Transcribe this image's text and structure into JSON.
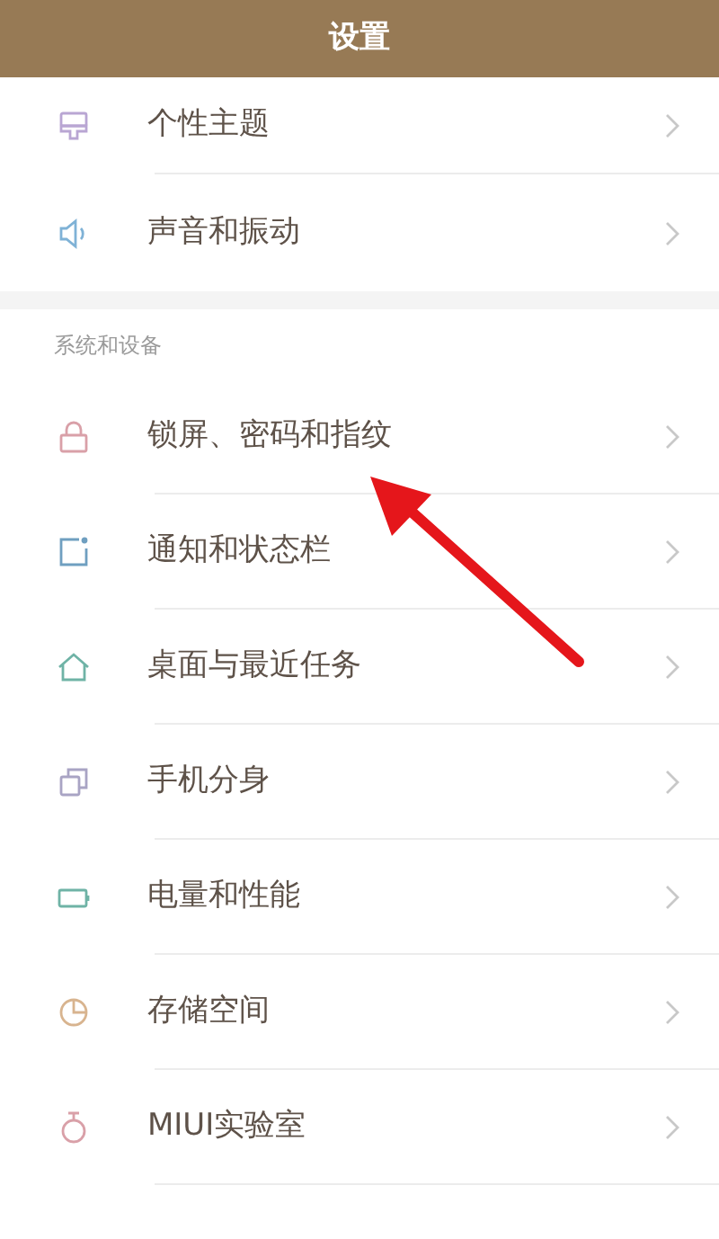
{
  "header": {
    "title": "设置"
  },
  "top_items": [
    {
      "label": "个性主题"
    },
    {
      "label": "声音和振动"
    }
  ],
  "section": {
    "title": "系统和设备",
    "items": [
      {
        "label": "锁屏、密码和指纹"
      },
      {
        "label": "通知和状态栏"
      },
      {
        "label": "桌面与最近任务"
      },
      {
        "label": "手机分身"
      },
      {
        "label": "电量和性能"
      },
      {
        "label": "存储空间"
      },
      {
        "label": "MIUI实验室"
      }
    ]
  }
}
